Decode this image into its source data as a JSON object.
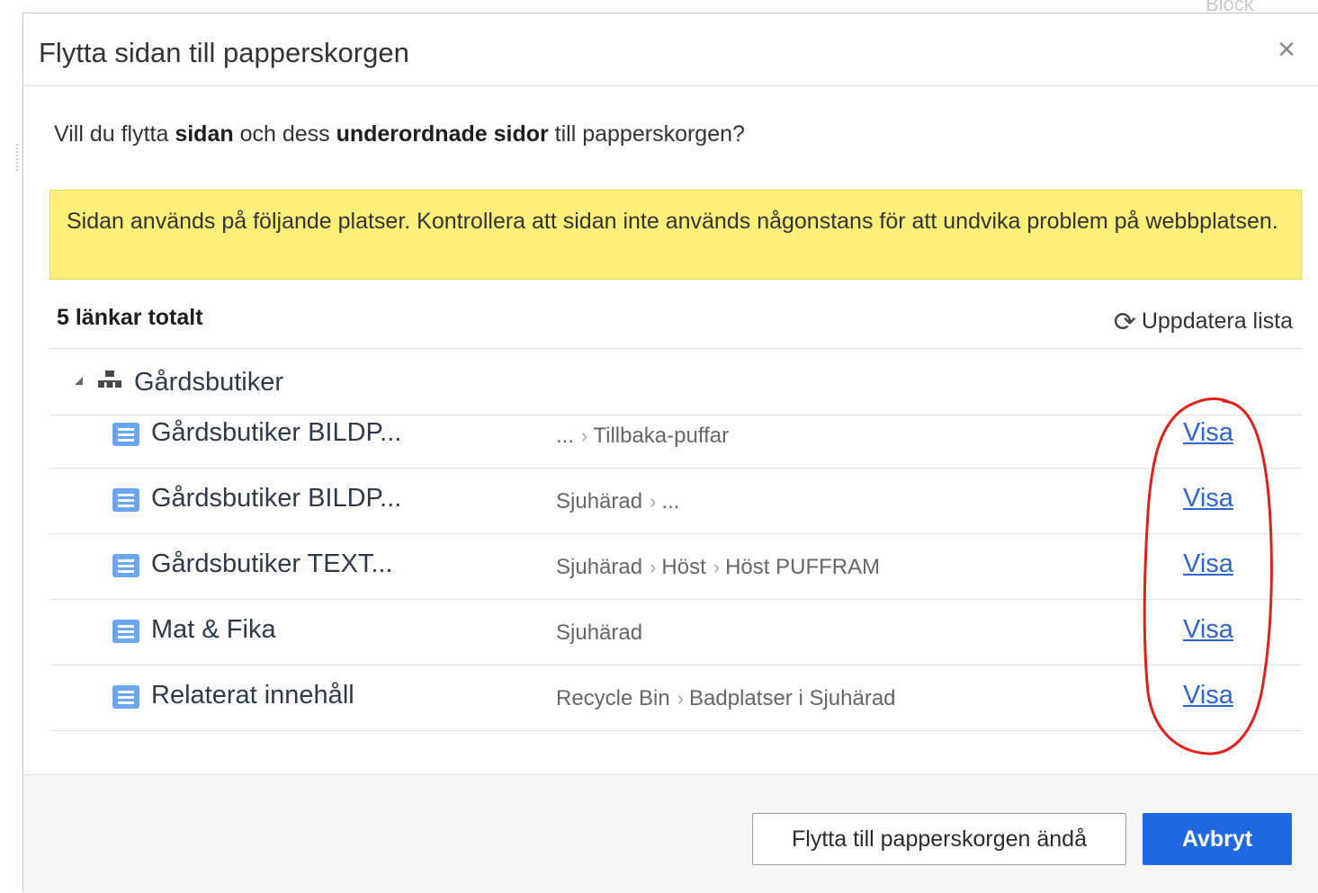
{
  "background": {
    "peek_text": "Block"
  },
  "dialog": {
    "title": "Flytta sidan till papperskorgen",
    "close_glyph": "×",
    "question": {
      "part1": "Vill du flytta ",
      "bold1": "sidan",
      "part2": " och dess ",
      "bold2": "underordnade sidor",
      "part3": " till papperskorgen?"
    },
    "warning": "Sidan används på följande platser. Kontrollera att sidan inte används någonstans för att undvika problem på webbplatsen.",
    "list_header": {
      "total": "5 länkar totalt",
      "refresh_label": "Uppdatera lista",
      "refresh_icon": "refresh-icon"
    },
    "group": {
      "label": "Gårdsbutiker",
      "icon": "site-tree-icon"
    },
    "rows": [
      {
        "title": "Gårdsbutiker BILDP...",
        "path": [
          "...",
          "Tillbaka-puffar"
        ],
        "link": "Visa"
      },
      {
        "title": "Gårdsbutiker BILDP...",
        "path": [
          "Sjuhärad",
          "..."
        ],
        "link": "Visa"
      },
      {
        "title": "Gårdsbutiker TEXT...",
        "path": [
          "Sjuhärad",
          "Höst",
          "Höst PUFFRAM"
        ],
        "link": "Visa"
      },
      {
        "title": "Mat & Fika",
        "path": [
          "Sjuhärad"
        ],
        "link": "Visa"
      },
      {
        "title": "Relaterat innehåll",
        "path": [
          "Recycle Bin",
          "Badplatser i Sjuhärad"
        ],
        "link": "Visa"
      }
    ],
    "footer": {
      "secondary_button": "Flytta till papperskorgen ändå",
      "primary_button": "Avbryt"
    }
  },
  "colors": {
    "warning_bg": "#fdf07a",
    "primary": "#1f6ae0",
    "link": "#2f66c9",
    "doc_icon": "#6ba6f3",
    "annotation": "#e0201b"
  }
}
